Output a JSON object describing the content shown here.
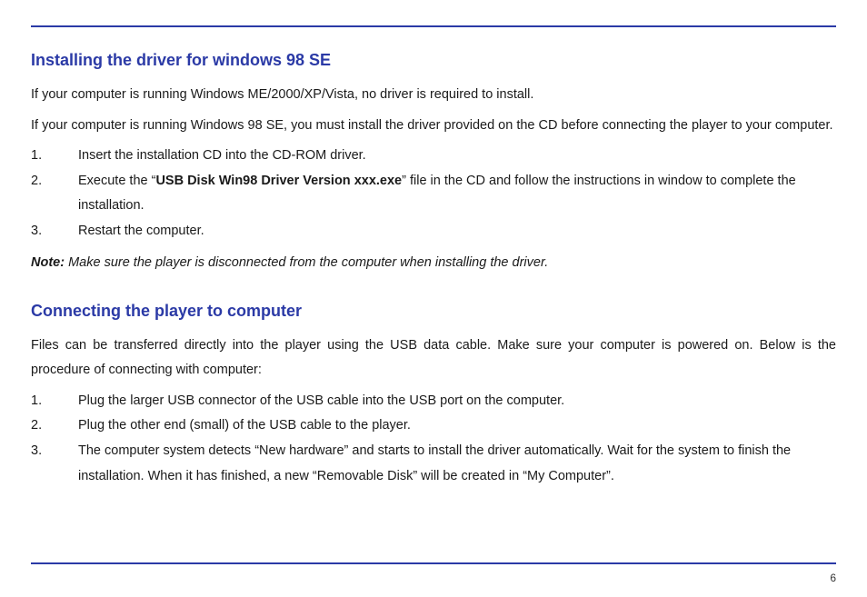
{
  "section1": {
    "heading": "Installing the driver for windows 98 SE",
    "p1": "If your computer is running Windows ME/2000/XP/Vista, no driver is required to install.",
    "p2": "If your computer is running Windows 98 SE, you must install the driver provided on the CD before connecting the player to your computer.",
    "steps": {
      "n1": "1.",
      "t1": "Insert the installation CD into the CD-ROM driver.",
      "n2": "2.",
      "t2a": "Execute the “",
      "t2bold": "USB Disk Win98 Driver Version xxx.exe",
      "t2b": "” file in the CD and follow the instructions in window to complete the installation.",
      "n3": "3.",
      "t3": "Restart the computer."
    },
    "note_label": "Note:",
    "note_text": " Make sure the player is disconnected from the computer when installing the driver."
  },
  "section2": {
    "heading": "Connecting the player to computer",
    "p1": "Files can be transferred directly into the player using the USB data cable. Make sure your computer is powered on. Below is the procedure of connecting with computer:",
    "steps": {
      "n1": "1.",
      "t1": "Plug the larger USB connector of the USB cable into the USB port on the computer.",
      "n2": "2.",
      "t2": "Plug the other end (small) of the USB cable to the player.",
      "n3": "3.",
      "t3": "The computer system detects “New hardware” and starts to install the driver automatically. Wait for the system to finish the installation. When it has finished, a new “Removable Disk” will be created in “My Computer”."
    }
  },
  "page_number": "6"
}
